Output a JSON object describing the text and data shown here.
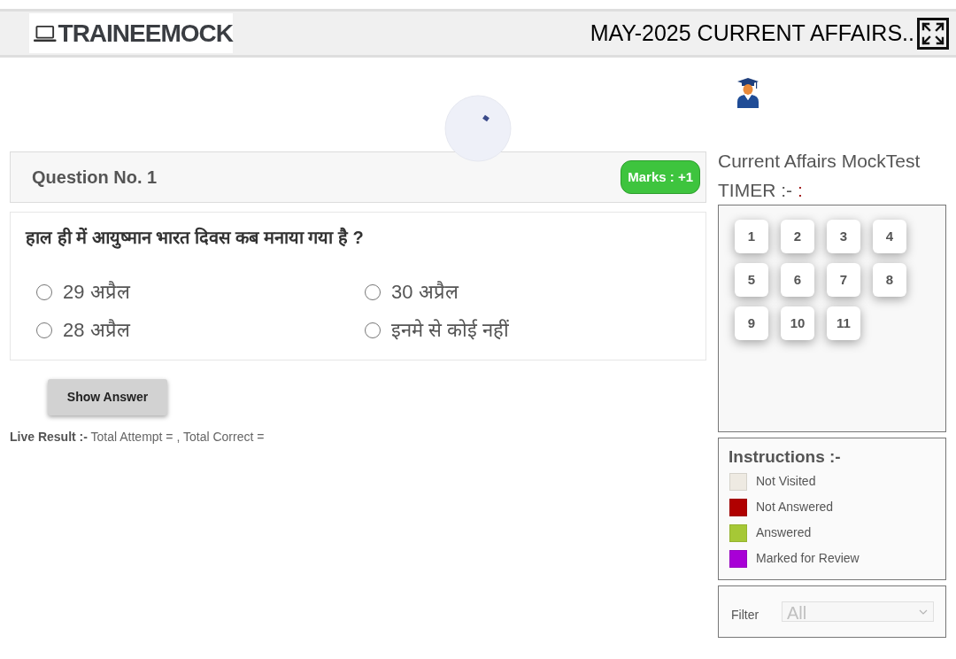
{
  "header": {
    "logo": "TRAINEEMOCK",
    "title": "MAY-2025 CURRENT AFFAIRS.."
  },
  "question": {
    "heading": "Question No. 1",
    "marks": "Marks : +1",
    "text": "हाल ही में आयुष्मान भारत दिवस कब मनाया गया है ?",
    "options": [
      {
        "label": "29 अप्रैल",
        "selected": false
      },
      {
        "label": "30 अप्रैल",
        "selected": false
      },
      {
        "label": "28 अप्रैल",
        "selected": false
      },
      {
        "label": "इनमे से कोई नहीं",
        "selected": false
      }
    ]
  },
  "show_answer_button": "Show Answer",
  "live_result": "**Live Result :-** Total Attempt = , Total Correct =",
  "sidebar": {
    "test_name": "Current Affairs MockTest",
    "timer": {
      "label": "TIMER :-",
      "value": ":"
    },
    "question_palette": [
      "1",
      "2",
      "3",
      "4",
      "5",
      "6",
      "7",
      "8",
      "9",
      "10",
      "11"
    ],
    "instructions": {
      "title": "Instructions :-",
      "legend": [
        {
          "label": "Not Visited",
          "color": "#eeeae2"
        },
        {
          "label": "Not Answered",
          "color": "#b00000"
        },
        {
          "label": "Answered",
          "color": "#a6c836"
        },
        {
          "label": "Marked for Review",
          "color": "#a800d6"
        }
      ]
    },
    "filter": {
      "label": "Filter",
      "value": "All",
      "disabled": true
    }
  }
}
